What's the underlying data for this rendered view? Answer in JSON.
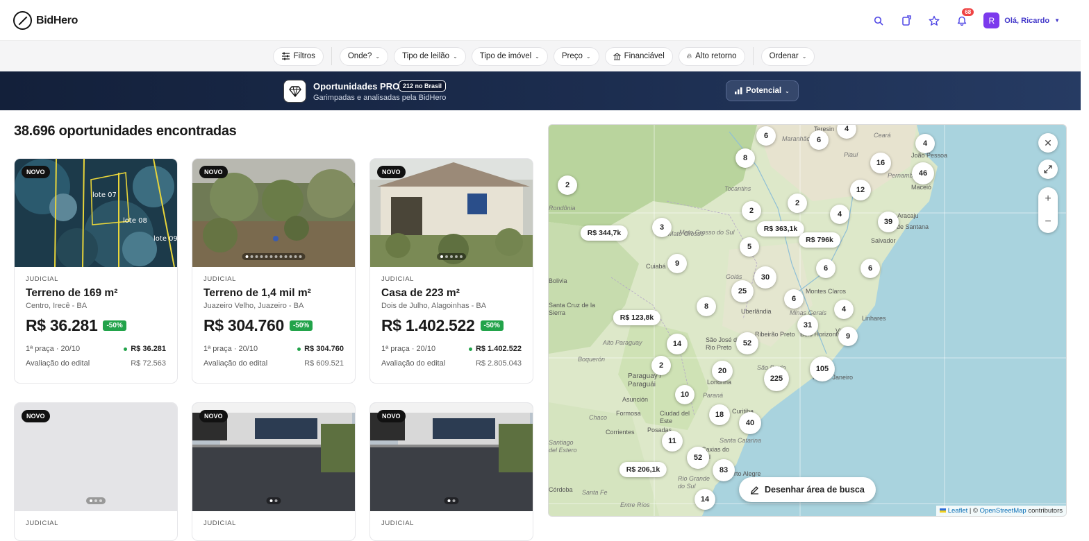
{
  "brand": {
    "name": "BidHero"
  },
  "header": {
    "notifications_count": "68",
    "avatar_initial": "R",
    "user_greeting": "Olá, Ricardo"
  },
  "filters": {
    "filters_label": "Filtros",
    "where_label": "Onde?",
    "auction_type_label": "Tipo de leilão",
    "property_type_label": "Tipo de imóvel",
    "price_label": "Preço",
    "financeable_label": "Financiável",
    "high_return_label": "Alto retorno",
    "sort_label": "Ordenar"
  },
  "pro_banner": {
    "title": "Oportunidades PRO",
    "chip": "212 no Brasil",
    "subtitle": "Garimpadas e analisadas pela BidHero",
    "potential_label": "Potencial"
  },
  "results": {
    "title": "38.696 oportunidades encontradas"
  },
  "cards": [
    {
      "badge": "NOVO",
      "type": "JUDICIAL",
      "title": "Terreno de 169 m²",
      "location": "Centro, Irecê - BA",
      "price": "R$ 36.281",
      "discount": "-50%",
      "round_label": "1ª praça · 20/10",
      "round_value": "R$ 36.281",
      "appraisal_label": "Avaliação do edital",
      "appraisal_value": "R$ 72.563",
      "photo_labels": [
        "lote 07",
        "lote 08",
        "lote 09"
      ]
    },
    {
      "badge": "NOVO",
      "type": "JUDICIAL",
      "title": "Terreno de 1,4 mil m²",
      "location": "Juazeiro Velho, Juazeiro - BA",
      "price": "R$ 304.760",
      "discount": "-50%",
      "round_label": "1ª praça · 20/10",
      "round_value": "R$ 304.760",
      "appraisal_label": "Avaliação do edital",
      "appraisal_value": "R$ 609.521"
    },
    {
      "badge": "NOVO",
      "type": "JUDICIAL",
      "title": "Casa de 223 m²",
      "location": "Dois de Julho, Alagoinhas - BA",
      "price": "R$ 1.402.522",
      "discount": "-50%",
      "round_label": "1ª praça · 20/10",
      "round_value": "R$ 1.402.522",
      "appraisal_label": "Avaliação do edital",
      "appraisal_value": "R$ 2.805.043"
    },
    {
      "badge": "NOVO",
      "type": "JUDICIAL"
    },
    {
      "badge": "NOVO",
      "type": "JUDICIAL"
    },
    {
      "badge": "NOVO",
      "type": "JUDICIAL"
    }
  ],
  "map": {
    "draw_label": "Desenhar área de busca",
    "attribution_leaflet": "Leaflet",
    "attribution_osm": "OpenStreetMap",
    "attribution_suffix": "contributors",
    "attribution_sep": "| ©",
    "clusters": [
      "6",
      "4",
      "6",
      "4",
      "8",
      "16",
      "46",
      "2",
      "12",
      "2",
      "2",
      "4",
      "39",
      "3",
      "5",
      "9",
      "6",
      "6",
      "30",
      "25",
      "6",
      "8",
      "4",
      "31",
      "9",
      "14",
      "52",
      "2",
      "20",
      "225",
      "105",
      "10",
      "18",
      "40",
      "11",
      "52",
      "83",
      "14",
      "4"
    ],
    "price_tags": [
      "R$ 344,7k",
      "R$ 363,1k",
      "R$ 796k",
      "R$ 123,8k",
      "R$ 206,1k"
    ],
    "place_labels": [
      "Teresin",
      "Maranhão",
      "Ceará",
      "Piauí",
      "João Pessoa",
      "Pernambuco",
      "Maceió",
      "Tocantins",
      "Rondônia",
      "Mato Grosso",
      "Cuiabá",
      "Bolivia",
      "Santa Cruz de la Sierra",
      "Goiás",
      "Uberlândia",
      "Montes Claros",
      "Minas Gerais",
      "Belo Horizonte",
      "Linhares",
      "Vitória",
      "São José do Rio Preto",
      "Ribeirão Preto",
      "São Paulo",
      "Rio de Janeiro",
      "Alto Paraguay",
      "Boquerón",
      "Paraguay / Paraguái",
      "Asunción",
      "Formosa",
      "Chaco",
      "Corrientes",
      "Ciudad del Este",
      "Posadas",
      "Paraná",
      "Curitiba",
      "Londrina",
      "Santa Catarina",
      "Caxias do Sul",
      "Porto Alegre",
      "Rio Grande do Sul",
      "Santa Fe",
      "Entre Ríos",
      "Córdoba",
      "Santiago del Estero",
      "Salvador",
      "Aracaju",
      "Feira de Santana",
      "Mato Grosso do Sul"
    ]
  }
}
